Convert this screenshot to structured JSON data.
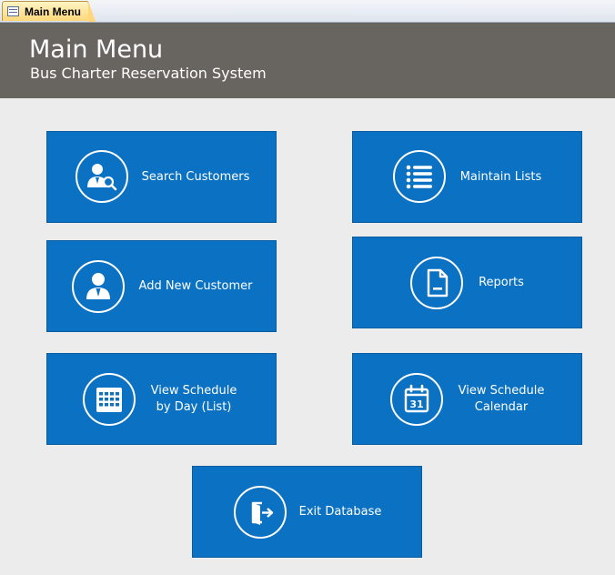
{
  "tab": {
    "label": "Main Menu",
    "icon": "form-icon"
  },
  "header": {
    "title": "Main Menu",
    "subtitle": "Bus Charter Reservation System",
    "background": "#686560"
  },
  "buttons": {
    "search_customers": {
      "label": "Search Customers",
      "icon": "customer-search-icon"
    },
    "maintain_lists": {
      "label": "Maintain Lists",
      "icon": "list-icon"
    },
    "add_new_customer": {
      "label": "Add New Customer",
      "icon": "add-customer-icon"
    },
    "reports": {
      "label": "Reports",
      "icon": "document-icon"
    },
    "view_schedule_day": {
      "label": "View Schedule\nby Day (List)",
      "icon": "calendar-grid-icon"
    },
    "view_schedule_calendar": {
      "label": "View Schedule\nCalendar",
      "icon": "calendar-31-icon"
    },
    "exit_database": {
      "label": "Exit Database",
      "icon": "exit-door-icon"
    }
  },
  "colors": {
    "button": "#0b71c2",
    "background": "#ececec"
  }
}
